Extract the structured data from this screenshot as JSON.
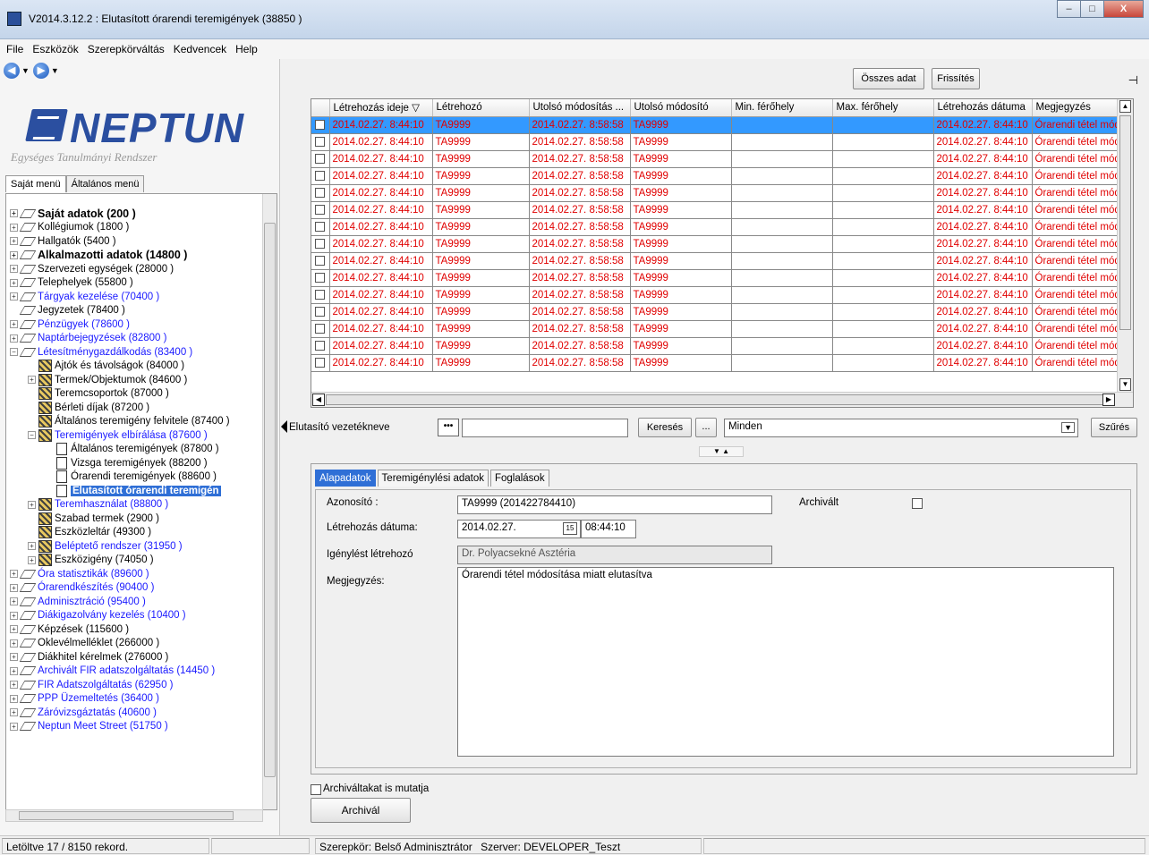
{
  "window": {
    "title": "V2014.3.12.2 : Elutasított órarendi teremigények (38850 )",
    "buttons": [
      "–",
      "□",
      "X"
    ]
  },
  "menubar": [
    "File",
    "Eszközök",
    "Szerepkörváltás",
    "Kedvencek",
    "Help"
  ],
  "logo": {
    "name": "NEPTUN",
    "subtitle": "Egységes Tanulmányi Rendszer"
  },
  "menu_tabs": [
    "Saját menü",
    "Általános menü"
  ],
  "tree": [
    {
      "label": "Saját adatok (200 )",
      "depth": 0,
      "exp": "+",
      "icon": "t",
      "style": "bold"
    },
    {
      "label": "Kollégiumok (1800 )",
      "depth": 0,
      "exp": "+",
      "icon": "t",
      "style": ""
    },
    {
      "label": "Hallgatók (5400 )",
      "depth": 0,
      "exp": "+",
      "icon": "t",
      "style": ""
    },
    {
      "label": "Alkalmazotti adatok (14800 )",
      "depth": 0,
      "exp": "+",
      "icon": "t",
      "style": "bold"
    },
    {
      "label": "Szervezeti egységek (28000 )",
      "depth": 0,
      "exp": "+",
      "icon": "t",
      "style": ""
    },
    {
      "label": "Telephelyek (55800 )",
      "depth": 0,
      "exp": "+",
      "icon": "t",
      "style": ""
    },
    {
      "label": "Tárgyak kezelése (70400 )",
      "depth": 0,
      "exp": "+",
      "icon": "t",
      "style": "blue"
    },
    {
      "label": "Jegyzetek (78400 )",
      "depth": 0,
      "exp": "",
      "icon": "t",
      "style": ""
    },
    {
      "label": "Pénzügyek (78600 )",
      "depth": 0,
      "exp": "+",
      "icon": "t",
      "style": "blue"
    },
    {
      "label": "Naptárbejegyzések (82800 )",
      "depth": 0,
      "exp": "+",
      "icon": "t",
      "style": "blue"
    },
    {
      "label": "Létesítménygazdálkodás (83400 )",
      "depth": 0,
      "exp": "−",
      "icon": "t",
      "style": "blue"
    },
    {
      "label": "Ajtók és távolságok (84000 )",
      "depth": 1,
      "exp": "",
      "icon": "f",
      "style": ""
    },
    {
      "label": "Termek/Objektumok (84600 )",
      "depth": 1,
      "exp": "+",
      "icon": "f",
      "style": ""
    },
    {
      "label": "Teremcsoportok (87000 )",
      "depth": 1,
      "exp": "",
      "icon": "f",
      "style": ""
    },
    {
      "label": "Bérleti díjak (87200 )",
      "depth": 1,
      "exp": "",
      "icon": "f",
      "style": ""
    },
    {
      "label": "Általános teremigény felvitele (87400 )",
      "depth": 1,
      "exp": "",
      "icon": "f",
      "style": ""
    },
    {
      "label": "Teremigények elbírálása (87600 )",
      "depth": 1,
      "exp": "−",
      "icon": "f",
      "style": "blue"
    },
    {
      "label": "Általános teremigények (87800 )",
      "depth": 2,
      "exp": "",
      "icon": "p",
      "style": ""
    },
    {
      "label": "Vizsga teremigények (88200 )",
      "depth": 2,
      "exp": "",
      "icon": "p",
      "style": ""
    },
    {
      "label": "Órarendi teremigények (88600 )",
      "depth": 2,
      "exp": "",
      "icon": "p",
      "style": ""
    },
    {
      "label": "Elutasított órarendi teremigén",
      "depth": 2,
      "exp": "",
      "icon": "p",
      "style": "sel"
    },
    {
      "label": "Teremhasználat (88800 )",
      "depth": 1,
      "exp": "+",
      "icon": "f",
      "style": "blue"
    },
    {
      "label": "Szabad termek (2900 )",
      "depth": 1,
      "exp": "",
      "icon": "f",
      "style": ""
    },
    {
      "label": "Eszközleltár (49300 )",
      "depth": 1,
      "exp": "",
      "icon": "f",
      "style": ""
    },
    {
      "label": "Beléptető rendszer (31950 )",
      "depth": 1,
      "exp": "+",
      "icon": "f",
      "style": "blue"
    },
    {
      "label": "Eszközigény (74050 )",
      "depth": 1,
      "exp": "+",
      "icon": "f",
      "style": ""
    },
    {
      "label": "Óra statisztikák (89600 )",
      "depth": 0,
      "exp": "+",
      "icon": "t",
      "style": "blue"
    },
    {
      "label": "Órarendkészítés (90400 )",
      "depth": 0,
      "exp": "+",
      "icon": "t",
      "style": "blue"
    },
    {
      "label": "Adminisztráció (95400 )",
      "depth": 0,
      "exp": "+",
      "icon": "t",
      "style": "blue"
    },
    {
      "label": "Diákigazolvány kezelés (10400 )",
      "depth": 0,
      "exp": "+",
      "icon": "t",
      "style": "blue"
    },
    {
      "label": "Képzések (115600 )",
      "depth": 0,
      "exp": "+",
      "icon": "t",
      "style": ""
    },
    {
      "label": "Oklevélmelléklet (266000 )",
      "depth": 0,
      "exp": "+",
      "icon": "t",
      "style": ""
    },
    {
      "label": "Diákhitel kérelmek (276000 )",
      "depth": 0,
      "exp": "+",
      "icon": "t",
      "style": ""
    },
    {
      "label": "Archivált FIR adatszolgáltatás (14450 )",
      "depth": 0,
      "exp": "+",
      "icon": "t",
      "style": "blue"
    },
    {
      "label": "FIR Adatszolgáltatás (62950 )",
      "depth": 0,
      "exp": "+",
      "icon": "t",
      "style": "blue"
    },
    {
      "label": "PPP Üzemeltetés (36400 )",
      "depth": 0,
      "exp": "+",
      "icon": "t",
      "style": "blue"
    },
    {
      "label": "Záróvizsgáztatás (40600 )",
      "depth": 0,
      "exp": "+",
      "icon": "t",
      "style": "blue"
    },
    {
      "label": "Neptun Meet Street (51750 )",
      "depth": 0,
      "exp": "+",
      "icon": "t",
      "style": "blue"
    }
  ],
  "toolbar": {
    "all_data": "Összes adat",
    "refresh": "Frissítés",
    "pin": "⊣"
  },
  "grid": {
    "columns": [
      "Létrehozás ideje ▽",
      "Létrehozó",
      "Utolsó módosítás ...",
      "Utolsó módosító",
      "Min. férőhely",
      "Max. férőhely",
      "Létrehozás dátuma",
      "Megjegyzés"
    ],
    "row": [
      "2014.02.27. 8:44:10",
      "TA9999",
      "2014.02.27. 8:58:58",
      "TA9999",
      "",
      "",
      "2014.02.27. 8:44:10",
      "Órarendi tétel módosítása"
    ],
    "row_count": 15
  },
  "filter": {
    "label": "Elutasító vezetékneve",
    "dots": "•••",
    "search": "Keresés",
    "more": "...",
    "scope": "Minden",
    "filter_btn": "Szűrés"
  },
  "splitter": "▼ ▲",
  "detail_tabs": [
    "Alapadatok",
    "Teremigénylési adatok",
    "Foglalások"
  ],
  "detail": {
    "id_label": "Azonosító :",
    "id_value": "TA9999 (201422784410)",
    "archived_label": "Archivált",
    "created_label": "Létrehozás dátuma:",
    "created_date": "2014.02.27.",
    "created_time": "08:44:10",
    "cal_icon": "15",
    "requester_label": "Igénylést létrehozó",
    "requester_value": "Dr. Polyacsekné Asztéria",
    "note_label": "Megjegyzés:",
    "note_value": "Órarendi tétel módosítása miatt elutasítva"
  },
  "archive": {
    "show_archived": "Archiváltakat is mutatja",
    "archive_btn": "Archivál"
  },
  "status": {
    "records": "Letöltve 17 / 8150 rekord.",
    "role": "Szerepkör: Belső Adminisztrátor",
    "server": "Szerver: DEVELOPER_Teszt"
  },
  "colors": {
    "grid_text": "#e00000",
    "selection": "#3399ff",
    "tree_blue": "#1a1aff",
    "logo_blue": "#2b4fa0"
  }
}
